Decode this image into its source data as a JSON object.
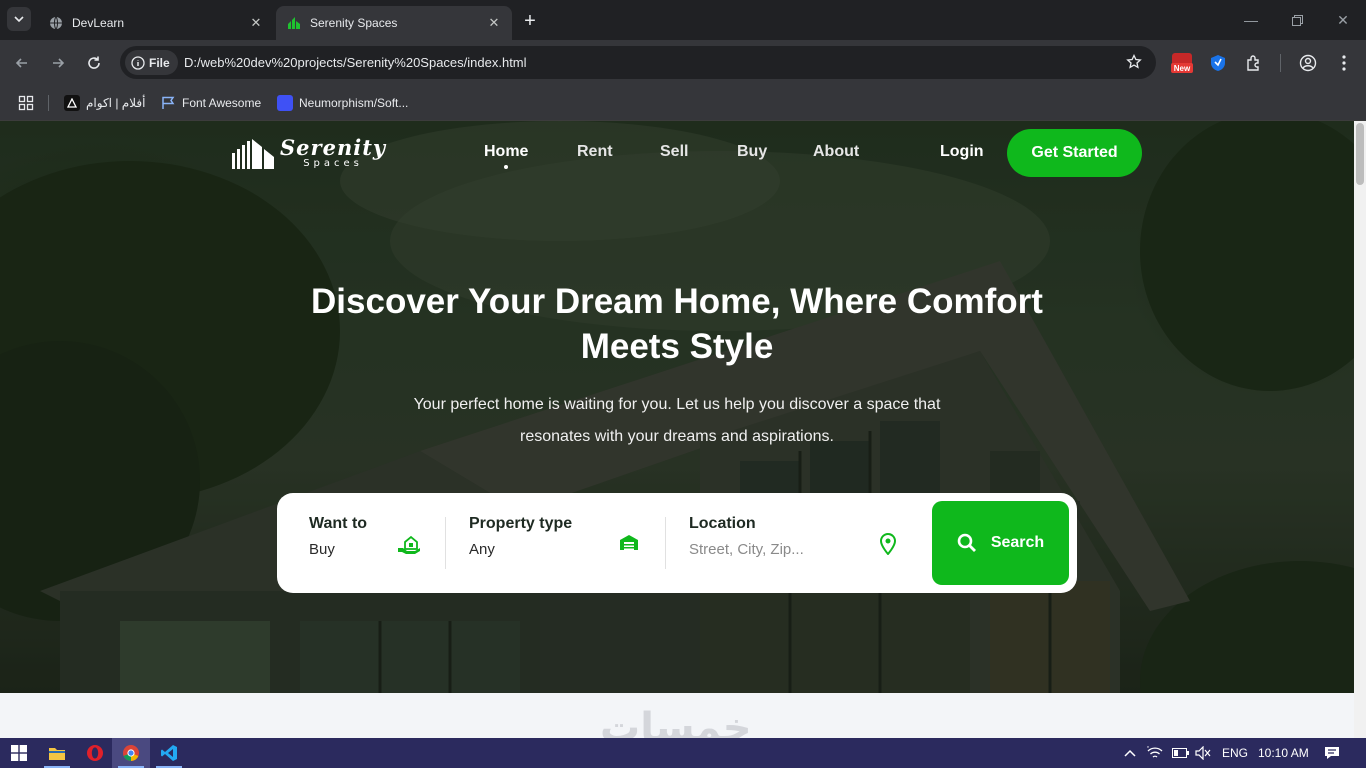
{
  "browser": {
    "tabs": [
      {
        "title": "DevLearn",
        "active": false
      },
      {
        "title": "Serenity Spaces",
        "active": true
      }
    ],
    "address": {
      "chip_label": "File",
      "url": "D:/web%20dev%20projects/Serenity%20Spaces/index.html"
    },
    "extension_badge": "New",
    "bookmarks": [
      {
        "label": "أفلام | اكوام"
      },
      {
        "label": "Font Awesome"
      },
      {
        "label": "Neumorphism/Soft..."
      }
    ]
  },
  "site": {
    "brand": {
      "name": "Serenity",
      "sub": "Spaces"
    },
    "nav": {
      "home": "Home",
      "rent": "Rent",
      "sell": "Sell",
      "buy": "Buy",
      "about": "About"
    },
    "login": "Login",
    "cta": "Get Started",
    "hero": {
      "title": "Discover Your Dream Home, Where Comfort Meets Style",
      "subtitle": "Your perfect home is waiting for you. Let us help you discover a space that resonates with your dreams and aspirations."
    },
    "search": {
      "want_label": "Want to",
      "want_value": "Buy",
      "type_label": "Property type",
      "type_value": "Any",
      "location_label": "Location",
      "location_placeholder": "Street, City, Zip...",
      "button": "Search"
    },
    "accent_color": "#0fb81c",
    "watermark": "خمسات"
  },
  "taskbar": {
    "apps": [
      "windows-start",
      "file-explorer",
      "opera",
      "chrome",
      "vscode"
    ],
    "language": "ENG",
    "time": "10:10 AM"
  }
}
